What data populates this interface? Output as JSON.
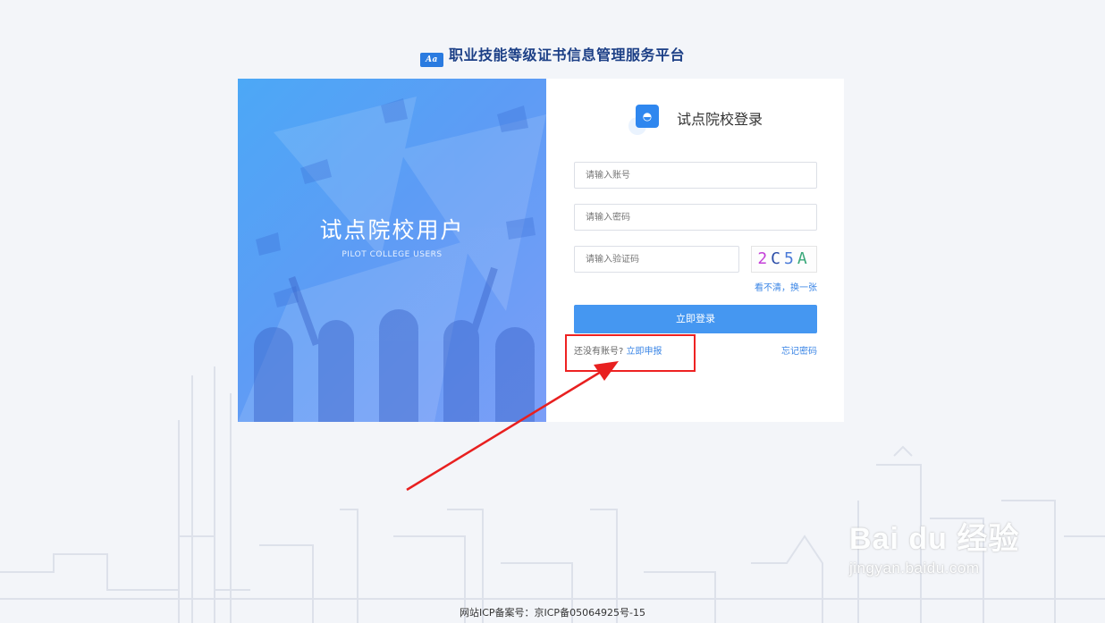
{
  "header": {
    "logo_text": "Aa",
    "title": "职业技能等级证书信息管理服务平台"
  },
  "banner": {
    "title": "试点院校用户",
    "subtitle": "PILOT COLLEGE USERS"
  },
  "login": {
    "title": "试点院校登录",
    "account_placeholder": "请输入账号",
    "password_placeholder": "请输入密码",
    "captcha_placeholder": "请输入验证码",
    "captcha_chars": [
      "2",
      "C",
      "5",
      "A"
    ],
    "captcha_colors": [
      "#c43fd8",
      "#2c4ea8",
      "#4a7ad8",
      "#3aa87a"
    ],
    "refresh_label": "看不清，换一张",
    "submit_label": "立即登录",
    "no_account_text": "还没有账号?",
    "register_label": "立即申报",
    "forgot_label": "忘记密码"
  },
  "footer": {
    "icp": "网站ICP备案号：京ICP备05064925号-15"
  },
  "watermark": {
    "brand": "Bai du 经验",
    "url": "jingyan.baidu.com"
  },
  "colors": {
    "accent": "#4597f1",
    "highlight": "#e22222",
    "brand": "#1c3f86"
  }
}
